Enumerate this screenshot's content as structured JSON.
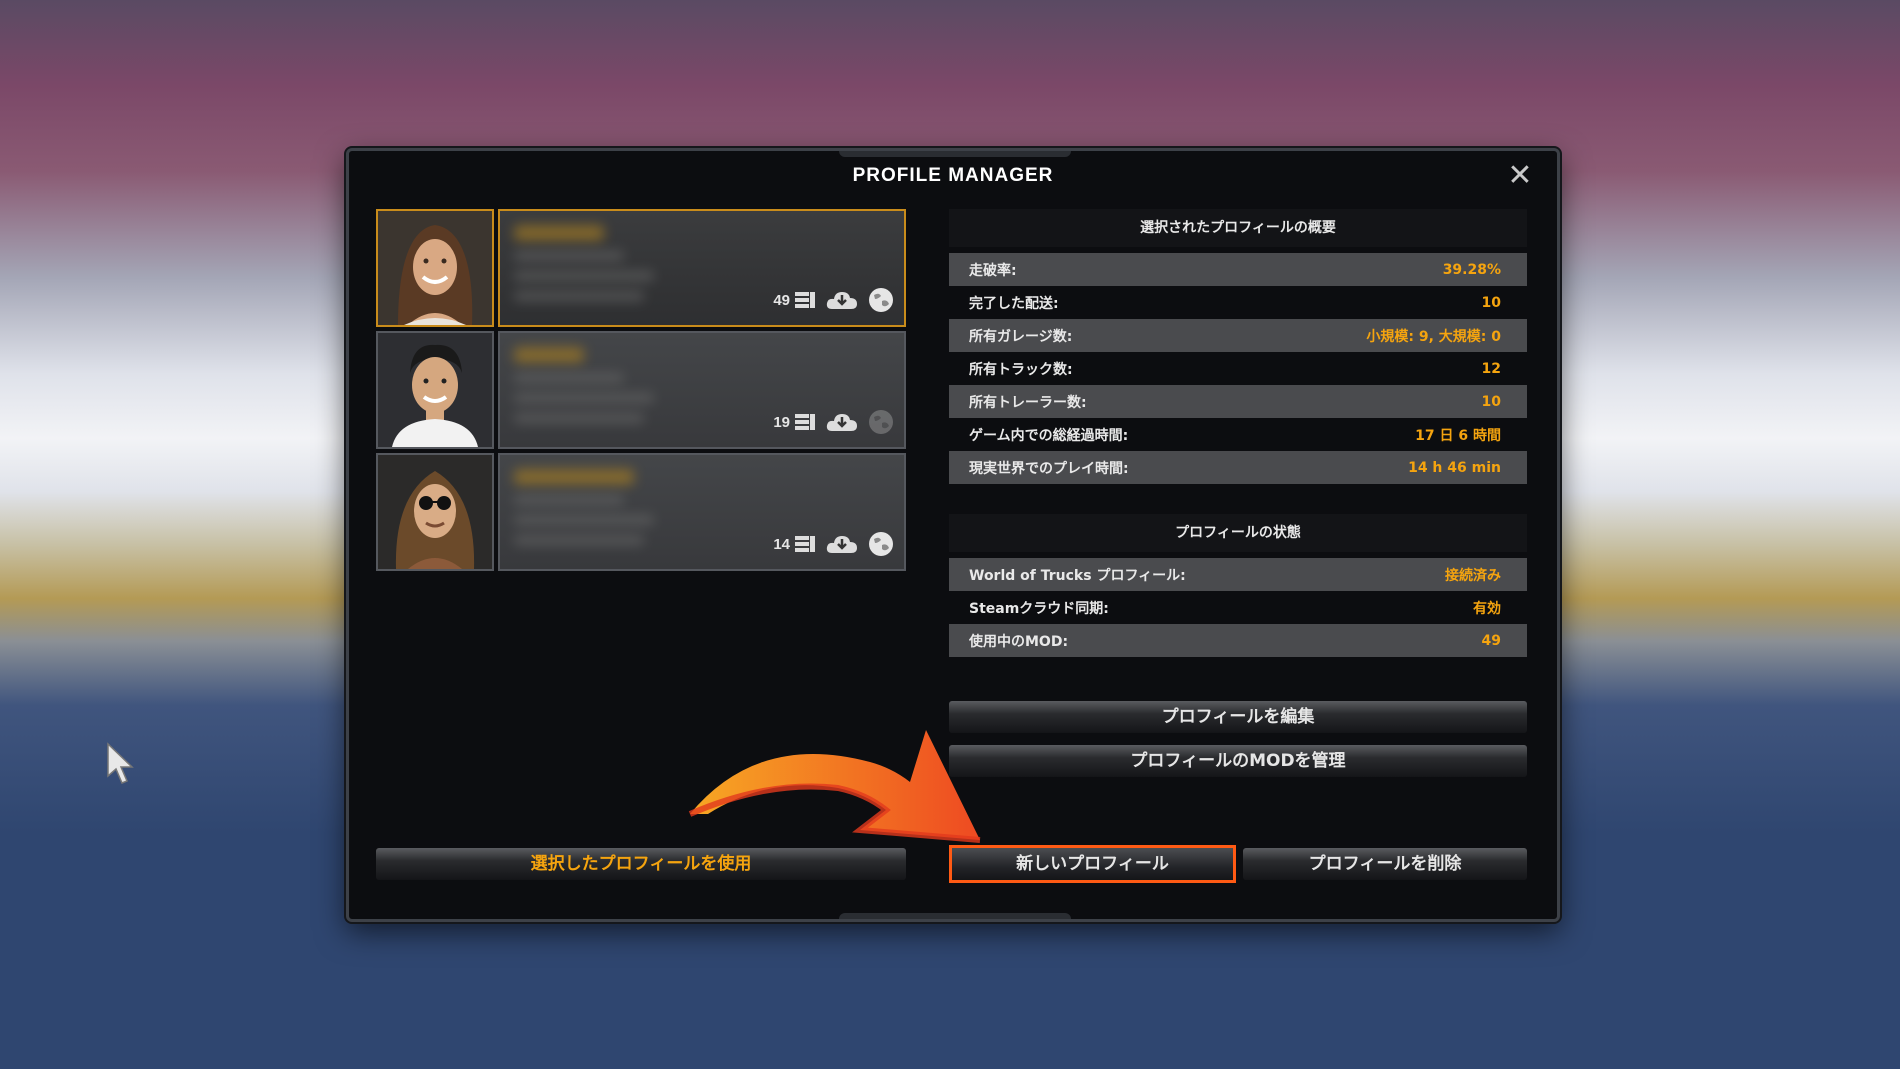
{
  "dialog": {
    "title": "PROFILE MANAGER",
    "close_icon": "close-icon"
  },
  "profiles": [
    {
      "mods": "49",
      "selected": true,
      "portrait": "woman-portrait"
    },
    {
      "mods": "19",
      "selected": false,
      "portrait": "man-portrait"
    },
    {
      "mods": "14",
      "selected": false,
      "portrait": "long-hair-man-sunglasses-portrait"
    }
  ],
  "summary": {
    "heading": "選択されたプロフィールの概要",
    "rows": [
      {
        "label": "走破率:",
        "value": "39.28%"
      },
      {
        "label": "完了した配送:",
        "value": "10"
      },
      {
        "label": "所有ガレージ数:",
        "value": "小規模: 9, 大規模: 0"
      },
      {
        "label": "所有トラック数:",
        "value": "12"
      },
      {
        "label": "所有トレーラー数:",
        "value": "10"
      },
      {
        "label": "ゲーム内での総経過時間:",
        "value": "17 日 6 時間"
      },
      {
        "label": "現実世界でのプレイ時間:",
        "value": "14 h 46 min"
      }
    ]
  },
  "status": {
    "heading": "プロフィールの状態",
    "rows": [
      {
        "label": "World of Trucks プロフィール:",
        "value": "接続済み"
      },
      {
        "label": "Steamクラウド同期:",
        "value": "有効"
      },
      {
        "label": "使用中のMOD:",
        "value": "49"
      }
    ]
  },
  "buttons": {
    "edit": "プロフィールを編集",
    "manage_mods": "プロフィールのMODを管理",
    "use_selected": "選択したプロフィールを使用",
    "new_profile": "新しいプロフィール",
    "delete_profile": "プロフィールを削除"
  },
  "colors": {
    "accent": "#f5a40f",
    "highlight": "#ff5a14",
    "selected_border": "#c98c1b"
  }
}
